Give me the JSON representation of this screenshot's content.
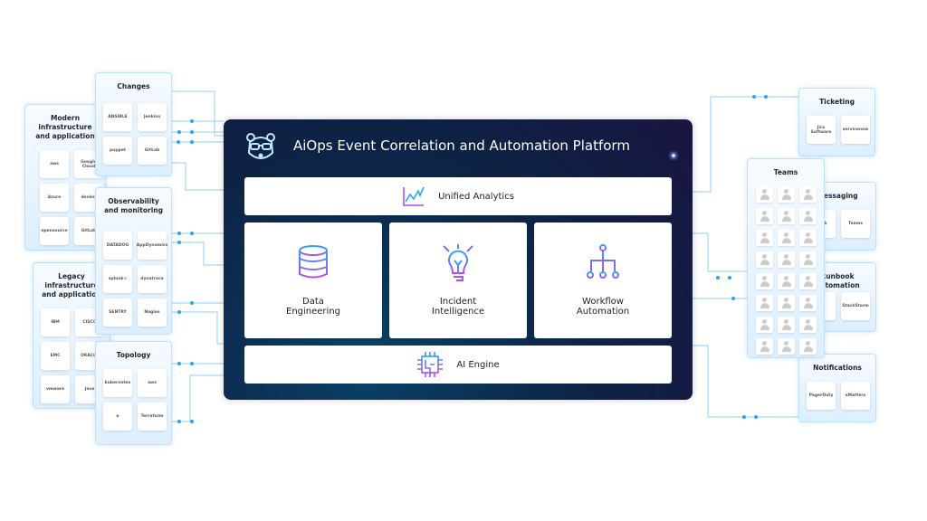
{
  "platform": {
    "title": "AiOps Event Correlation and Automation Platform",
    "unified": "Unified Analytics",
    "modules": [
      {
        "l1": "Data",
        "l2": "Engineering"
      },
      {
        "l1": "Incident",
        "l2": "Intelligence"
      },
      {
        "l1": "Workflow",
        "l2": "Automation"
      }
    ],
    "ai_engine": "AI Engine"
  },
  "inputs": [
    {
      "id": "modern",
      "title": "Modern infrastructure and application",
      "logos": [
        "aws",
        "Google Cloud",
        "Azure",
        "docker",
        "opensource",
        "GitLab"
      ]
    },
    {
      "id": "changes",
      "title": "Changes",
      "logos": [
        "ANSIBLE",
        "Jenkins",
        "puppet",
        "GitLab"
      ]
    },
    {
      "id": "legacy",
      "title": "Legacy infrastructure and application",
      "logos": [
        "IBM",
        "CISCO",
        "EMC",
        "ORACLE",
        "vmware",
        "Java"
      ]
    },
    {
      "id": "observability",
      "title": "Observability and monitoring",
      "logos": [
        "DATADOG",
        "AppDynamics",
        "splunk>",
        "dynatrace",
        "SENTRY",
        "Nagios"
      ]
    },
    {
      "id": "topology",
      "title": "Topology",
      "logos": [
        "kubernetes",
        "aws",
        "◈",
        "Terraform"
      ]
    }
  ],
  "outputs": [
    {
      "id": "ticketing",
      "title": "Ticketing",
      "logos": [
        "Jira Software",
        "servicenow"
      ]
    },
    {
      "id": "messaging",
      "title": "Messaging",
      "logos": [
        "slack",
        "Teams"
      ]
    },
    {
      "id": "runbook",
      "title": "Runbook Automation",
      "logos": [
        "",
        "StackStorm"
      ]
    },
    {
      "id": "notifications",
      "title": "Notifications",
      "logos": [
        "PagerDuty",
        "xMatters"
      ]
    }
  ],
  "teams": {
    "title": "Teams",
    "members": 24
  },
  "colors": {
    "accent": "#2aa5f0",
    "panel": "#0d2345",
    "icon_gradient": [
      "#2aa5f0",
      "#b44cf0"
    ]
  }
}
